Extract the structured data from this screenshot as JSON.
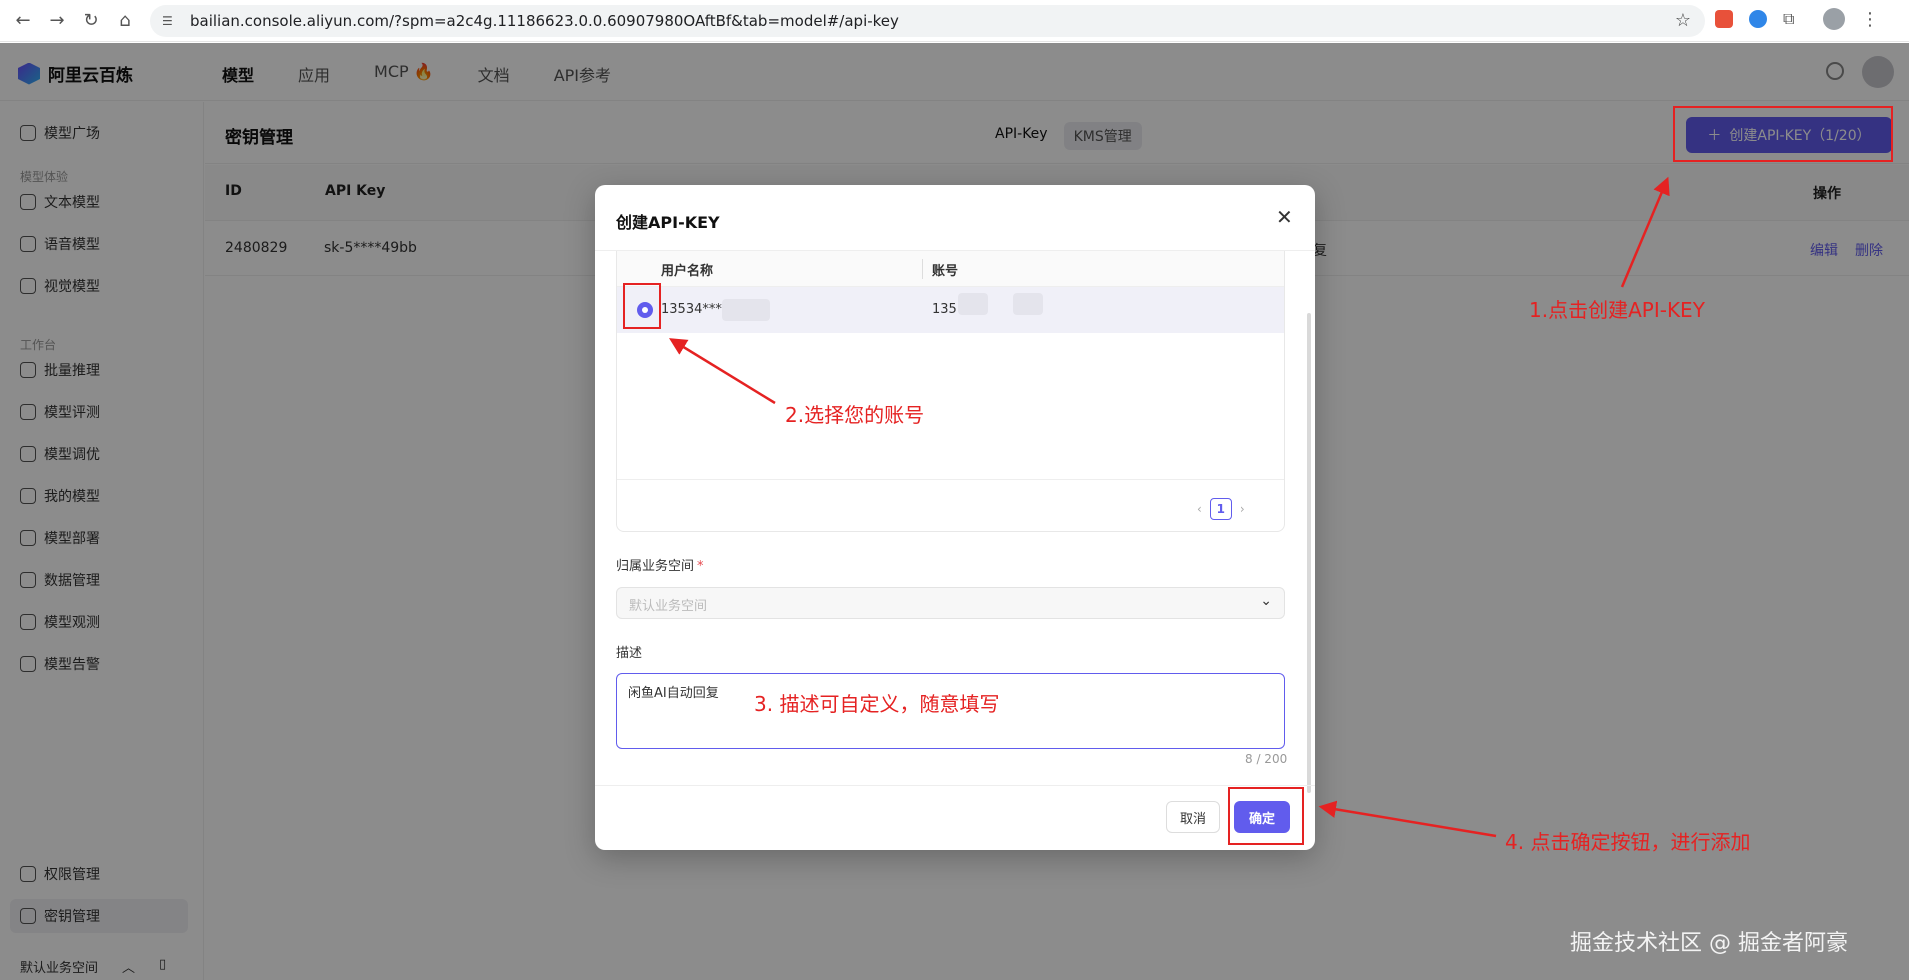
{
  "browser": {
    "url": "bailian.console.aliyun.com/?spm=a2c4g.11186623.0.0.60907980OAftBf&tab=model#/api-key"
  },
  "app": {
    "logo": "阿里云百炼",
    "tabs": [
      "模型",
      "应用",
      "MCP 🔥",
      "文档",
      "API参考"
    ]
  },
  "sidebar": {
    "items": [
      {
        "label": "模型广场"
      },
      {
        "group": "模型体验"
      },
      {
        "label": "文本模型"
      },
      {
        "label": "语音模型"
      },
      {
        "label": "视觉模型"
      },
      {
        "group": "工作台"
      },
      {
        "label": "批量推理"
      },
      {
        "label": "模型评测"
      },
      {
        "label": "模型调优"
      },
      {
        "label": "我的模型"
      },
      {
        "label": "模型部署"
      },
      {
        "label": "数据管理"
      },
      {
        "label": "模型观测"
      },
      {
        "label": "模型告警"
      }
    ],
    "bottom_items": [
      "权限管理",
      "密钥管理"
    ],
    "workspace": "默认业务空间"
  },
  "page": {
    "title": "密钥管理",
    "tab_active": "API-Key",
    "tab_inactive": "KMS管理",
    "create_button": "创建API-KEY（1/20）",
    "table": {
      "headers": [
        "ID",
        "API Key",
        "操作"
      ],
      "row": {
        "id": "2480829",
        "key": "sk-5****49bb",
        "desc_tail": "复",
        "edit": "编辑",
        "delete": "删除"
      }
    }
  },
  "modal": {
    "title": "创建API-KEY",
    "user_table": {
      "headers": [
        "用户名称",
        "账号"
      ],
      "row": {
        "username": "13534****",
        "account": "135"
      },
      "page": "1"
    },
    "workspace_label": "归属业务空间",
    "workspace_placeholder": "默认业务空间",
    "desc_label": "描述",
    "desc_value": "闲鱼AI自动回复",
    "counter": "8 / 200",
    "cancel": "取消",
    "ok": "确定"
  },
  "annotations": {
    "step1": "1.点击创建API-KEY",
    "step2": "2.选择您的账号",
    "step3": "3. 描述可自定义，随意填写",
    "step4": "4. 点击确定按钮，进行添加",
    "color": "#e52222"
  },
  "watermark": "掘金技术社区 @ 掘金者阿豪",
  "colors": {
    "accent": "#615ced"
  }
}
